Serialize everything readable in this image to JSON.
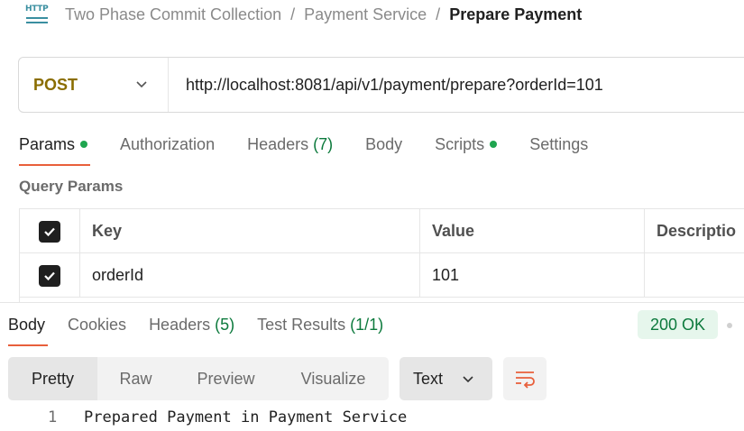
{
  "breadcrumb": {
    "icon": "http-request-icon",
    "icon_text": "HTTP",
    "items": [
      "Two Phase Commit Collection",
      "Payment Service",
      "Prepare Payment"
    ],
    "separator": "/"
  },
  "request": {
    "method": "POST",
    "method_color": "#8a6d00",
    "url": "http://localhost:8081/api/v1/payment/prepare?orderId=101"
  },
  "request_tabs": [
    {
      "label": "Params",
      "dot": true
    },
    {
      "label": "Authorization"
    },
    {
      "label": "Headers",
      "count": "(7)"
    },
    {
      "label": "Body"
    },
    {
      "label": "Scripts",
      "dot": true
    },
    {
      "label": "Settings"
    }
  ],
  "query_params": {
    "title": "Query Params",
    "columns": [
      "Key",
      "Value",
      "Descriptio"
    ],
    "rows": [
      {
        "checked": true,
        "key": "orderId",
        "value": "101",
        "description": ""
      }
    ]
  },
  "response": {
    "tabs": [
      {
        "label": "Body"
      },
      {
        "label": "Cookies"
      },
      {
        "label": "Headers",
        "count": "(5)"
      },
      {
        "label": "Test Results",
        "count": "(1/1)"
      }
    ],
    "status": "200 OK",
    "status_color": "#0d7a3d",
    "view_modes": [
      "Pretty",
      "Raw",
      "Preview",
      "Visualize"
    ],
    "selected_view": "Pretty",
    "format": "Text",
    "body_lines": [
      {
        "num": "1",
        "text": "Prepared Payment in Payment Service"
      }
    ]
  },
  "accent_color": "#e85f3b"
}
